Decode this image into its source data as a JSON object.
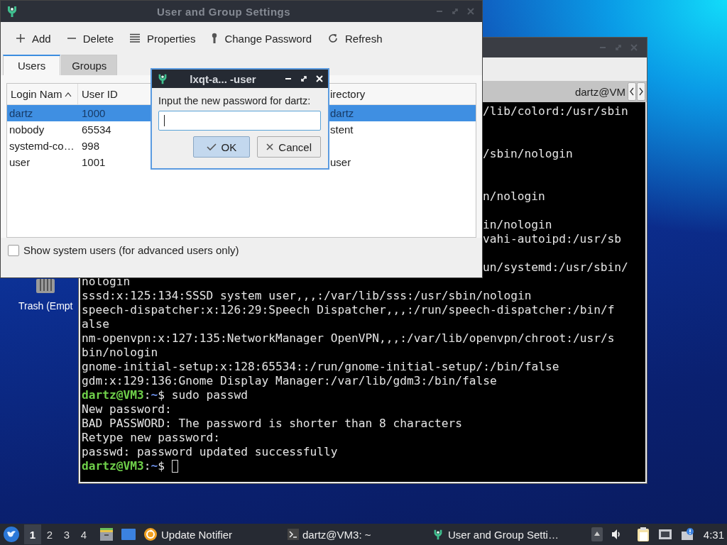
{
  "desktop": {
    "icons": [
      {
        "label": "Trash (Empt"
      }
    ]
  },
  "terminal": {
    "tab_title": "dartz@VM",
    "lines": [
      {
        "kind": "cut",
        "text": "/lib/colord:/usr/sbin"
      },
      {
        "kind": "hidden"
      },
      {
        "kind": "hidden"
      },
      {
        "kind": "cut",
        "text": "/sbin/nologin"
      },
      {
        "kind": "hidden"
      },
      {
        "kind": "hidden"
      },
      {
        "kind": "cut",
        "text": "n/nologin"
      },
      {
        "kind": "hidden"
      },
      {
        "kind": "cut",
        "text": "in/nologin"
      },
      {
        "kind": "cut",
        "text": "vahi-autoipd:/usr/sb"
      },
      {
        "kind": "hidden"
      },
      {
        "kind": "cut",
        "text": "un/systemd:/usr/sbin/"
      },
      {
        "kind": "output",
        "text": "nologin"
      },
      {
        "kind": "output",
        "text": "sssd:x:125:134:SSSD system user,,,:/var/lib/sss:/usr/sbin/nologin"
      },
      {
        "kind": "output",
        "text": "speech-dispatcher:x:126:29:Speech Dispatcher,,,:/run/speech-dispatcher:/bin/f"
      },
      {
        "kind": "output",
        "text": "alse"
      },
      {
        "kind": "output",
        "text": "nm-openvpn:x:127:135:NetworkManager OpenVPN,,,:/var/lib/openvpn/chroot:/usr/s"
      },
      {
        "kind": "output",
        "text": "bin/nologin"
      },
      {
        "kind": "output",
        "text": "gnome-initial-setup:x:128:65534::/run/gnome-initial-setup/:/bin/false"
      },
      {
        "kind": "output",
        "text": "gdm:x:129:136:Gnome Display Manager:/var/lib/gdm3:/bin/false"
      },
      {
        "kind": "prompt",
        "host": "dartz@VM3",
        "sep": ":",
        "path": "~",
        "command": "$ sudo passwd"
      },
      {
        "kind": "output",
        "text": "New password:"
      },
      {
        "kind": "output",
        "text": "BAD PASSWORD: The password is shorter than 8 characters"
      },
      {
        "kind": "output",
        "text": "Retype new password:"
      },
      {
        "kind": "output",
        "text": "passwd: password updated successfully"
      },
      {
        "kind": "active_prompt",
        "host": "dartz@VM3",
        "sep": ":",
        "path": "~",
        "command": "$"
      }
    ]
  },
  "settings": {
    "title": "User and Group Settings",
    "toolbar": [
      {
        "label": "Add"
      },
      {
        "label": "Delete"
      },
      {
        "label": "Properties"
      },
      {
        "label": "Change Password"
      },
      {
        "label": "Refresh"
      }
    ],
    "tabs": [
      {
        "label": "Users",
        "selected": true
      },
      {
        "label": "Groups",
        "selected": false
      }
    ],
    "table": {
      "columns": [
        "Login Nam",
        "User ID",
        "irectory"
      ],
      "rows": [
        {
          "login": "dartz",
          "uid": "1000",
          "directory": "dartz",
          "selected": true
        },
        {
          "login": "nobody",
          "uid": "65534",
          "directory": "stent",
          "selected": false
        },
        {
          "login": "systemd-co…",
          "uid": "998",
          "selected": false
        },
        {
          "login": "user",
          "uid": "1001",
          "directory": "user",
          "selected": false
        }
      ]
    },
    "show_system_users": {
      "label": "Show system users (for advanced users only)",
      "checked": false
    }
  },
  "dialog": {
    "title": "lxqt-a... -user",
    "prompt": "Input the new password for dartz:",
    "buttons": [
      {
        "label": "OK",
        "default": true
      },
      {
        "label": "Cancel",
        "default": false
      }
    ]
  },
  "taskbar": {
    "desktops": [
      {
        "label": "1",
        "selected": true
      },
      {
        "label": "2",
        "selected": false
      },
      {
        "label": "3",
        "selected": false
      },
      {
        "label": "4",
        "selected": false
      }
    ],
    "tasks": [
      {
        "label": "Update Notifier"
      },
      {
        "label": "dartz@VM3: ~"
      },
      {
        "label": "User and Group Setti…"
      }
    ],
    "clock": "4:31"
  }
}
